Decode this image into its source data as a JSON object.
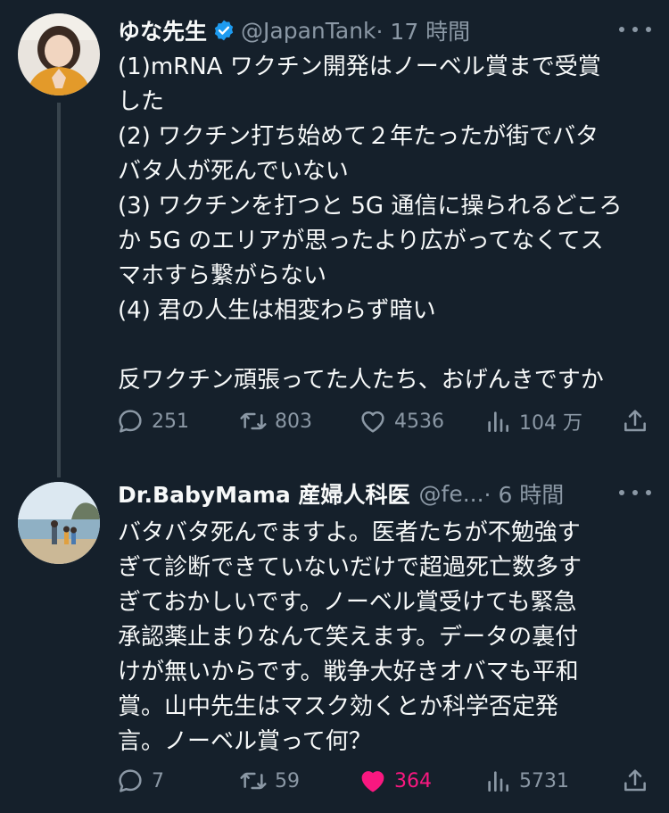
{
  "tweets": [
    {
      "display_name": "ゆな先生",
      "verified": true,
      "handle": "@JapanTank",
      "time": "· 17 時間",
      "text": "(1)mRNA ワクチン開発はノーベル賞まで受賞\nした\n(2) ワクチン打ち始めて２年たったが街でバタ\nバタ人が死んでいない\n(3) ワクチンを打つと 5G 通信に操られるどころ\nか 5G のエリアが思ったより広がってなくてス\nマホすら繋がらない\n(4) 君の人生は相変わらず暗い\n\n反ワクチン頑張ってた人たち、おげんきですか",
      "replies": "251",
      "retweets": "803",
      "likes": "4536",
      "views": "104 万",
      "liked": false
    },
    {
      "display_name": "Dr.BabyMama 産婦人科医",
      "verified": false,
      "handle": "@fe...",
      "time": "· 6 時間",
      "text": "バタバタ死んでますよ。医者たちが不勉強す\nぎて診断できていないだけで超過死亡数多す\nぎておかしいです。ノーベル賞受けても緊急\n承認薬止まりなんて笑えます。データの裏付\nけが無いからです。戦争大好きオバマも平和\n賞。山中先生はマスク効くとか科学否定発\n言。ノーベル賞って何？",
      "replies": "7",
      "retweets": "59",
      "likes": "364",
      "views": "5731",
      "liked": true
    }
  ],
  "icons": {
    "reply": "reply-icon",
    "retweet": "retweet-icon",
    "like": "heart-icon",
    "views": "views-icon",
    "share": "share-icon",
    "more": "more-icon",
    "verified": "verified-badge-icon"
  },
  "colors": {
    "background": "#15202b",
    "text": "#f7f9f9",
    "secondary": "#8b98a5",
    "like_active": "#f91880",
    "verified": "#1d9bf0"
  }
}
